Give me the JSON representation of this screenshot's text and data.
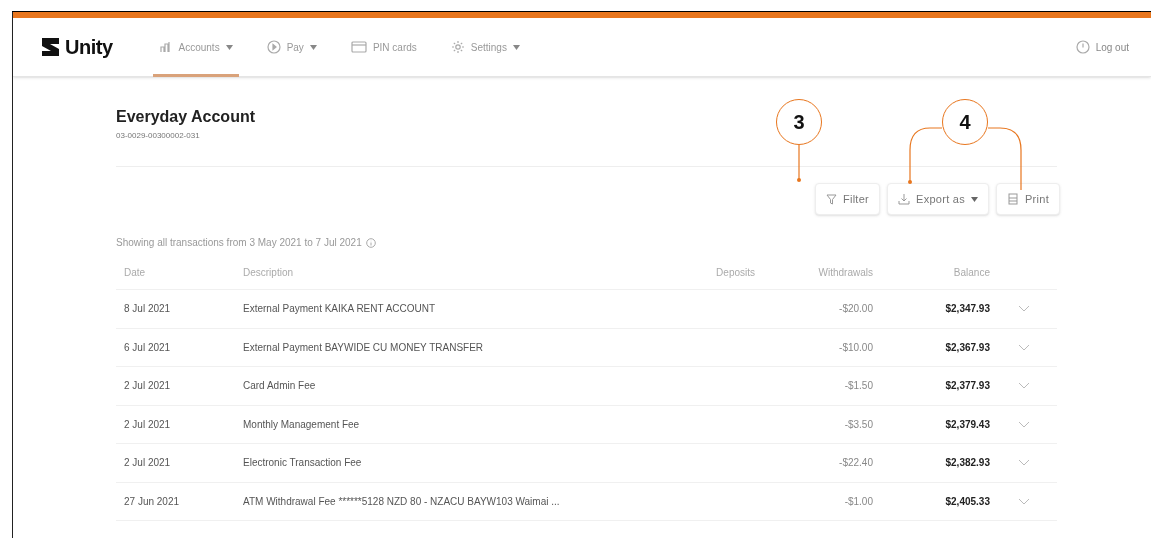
{
  "brand": {
    "name": "Unity"
  },
  "nav": [
    {
      "label": "Accounts",
      "caret": true,
      "selected": true,
      "kind": "accounts"
    },
    {
      "label": "Pay",
      "caret": true,
      "selected": false,
      "kind": "pay"
    },
    {
      "label": "PIN cards",
      "caret": false,
      "selected": false,
      "kind": "card"
    },
    {
      "label": "Settings",
      "caret": true,
      "selected": false,
      "kind": "gear"
    }
  ],
  "logout": {
    "label": "Log out"
  },
  "account": {
    "title": "Everyday Account",
    "number": "03-0029-00300002-031"
  },
  "toolbar": [
    {
      "label": "Filter",
      "kind": "filter",
      "caret": false
    },
    {
      "label": "Export as",
      "kind": "download",
      "caret": true
    },
    {
      "label": "Print",
      "kind": "print",
      "caret": false
    }
  ],
  "summary": "Showing all transactions from 3 May 2021 to 7 Jul 2021",
  "table": {
    "columns": [
      "Date",
      "Description",
      "Deposits",
      "Withdrawals",
      "Balance"
    ],
    "rows": [
      {
        "date": "8 Jul 2021",
        "description": "External Payment KAIKA RENT ACCOUNT",
        "withdrawal": "-$20.00",
        "balance": "$2,347.93"
      },
      {
        "date": "6 Jul 2021",
        "description": "External Payment BAYWIDE CU MONEY TRANSFER",
        "withdrawal": "-$10.00",
        "balance": "$2,367.93"
      },
      {
        "date": "2 Jul 2021",
        "description": "Card Admin Fee",
        "withdrawal": "-$1.50",
        "balance": "$2,377.93"
      },
      {
        "date": "2 Jul 2021",
        "description": "Monthly Management Fee",
        "withdrawal": "-$3.50",
        "balance": "$2,379.43"
      },
      {
        "date": "2 Jul 2021",
        "description": "Electronic Transaction Fee",
        "withdrawal": "-$22.40",
        "balance": "$2,382.93"
      },
      {
        "date": "27 Jun 2021",
        "description": "ATM Withdrawal Fee ******5128 NZD 80 - NZACU BAYW103 Waimai ...",
        "withdrawal": "-$1.00",
        "balance": "$2,405.33"
      }
    ]
  },
  "callouts": [
    {
      "number": "3"
    },
    {
      "number": "4"
    }
  ]
}
